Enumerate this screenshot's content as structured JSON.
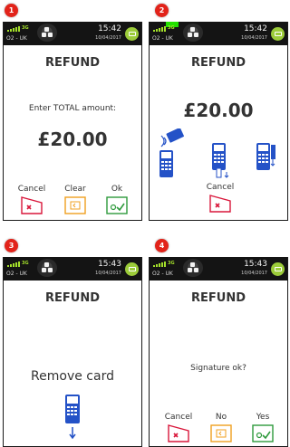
{
  "status": {
    "network": "3G",
    "carrier": "O2 - UK"
  },
  "steps": [
    {
      "number": "1",
      "time": "15:42",
      "date": "10/04/2017",
      "title": "REFUND",
      "prompt": "Enter TOTAL amount:",
      "amount": "£20.00",
      "keys": {
        "cancel": "Cancel",
        "clear": "Clear",
        "ok": "Ok"
      }
    },
    {
      "number": "2",
      "time": "15:42",
      "date": "10/04/2017",
      "title": "REFUND",
      "amount": "£20.00",
      "keys": {
        "cancel": "Cancel"
      },
      "icons": [
        "tap-card-icon",
        "insert-card-icon",
        "swipe-card-icon"
      ]
    },
    {
      "number": "3",
      "time": "15:43",
      "date": "10/04/2017",
      "title": "REFUND",
      "prompt": "Remove card",
      "icons": [
        "remove-card-icon"
      ]
    },
    {
      "number": "4",
      "time": "15:43",
      "date": "10/04/2017",
      "title": "REFUND",
      "prompt": "Signature ok?",
      "keys": {
        "cancel": "Cancel",
        "no": "No",
        "yes": "Yes"
      }
    }
  ],
  "colors": {
    "badge": "#e2231a",
    "cancel": "#d9163a",
    "clear": "#f0a020",
    "ok": "#2e9a3c",
    "terminal": "#2452c7",
    "signal": "#a4e02a",
    "progress": "#22e000"
  }
}
